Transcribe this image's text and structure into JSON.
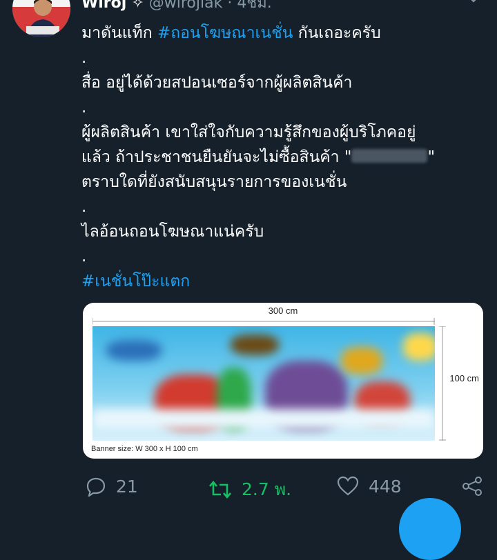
{
  "tweet": {
    "author_name": "Wiroj",
    "author_name_tail": "✧",
    "handle": "@wirojlak",
    "separator": "·",
    "time": "4ชม.",
    "lines": {
      "l1_pre": "มาดันแท็ก ",
      "l1_tag": "#ถอนโฆษณาเนชั่น",
      "l1_post": " กันเถอะครับ",
      "dot1": ".",
      "l2": "สื่อ อยู่ได้ด้วยสปอนเซอร์จากผู้ผลิตสินค้า",
      "dot2": ".",
      "l3": "ผู้ผลิตสินค้า เขาใส่ใจกับความรู้สึกของผู้บริโภคอยู่",
      "l4_pre": "แล้ว ถ้าประชาชนยืนยันจะไม่ซื้อสินค้า \"",
      "l4_post": "\"",
      "l5": "ตราบใดที่ยังสนับสนุนรายการของเนชั่น",
      "dot3": ".",
      "l6": "ไลอ้อนถอนโฆษณาแน่ครับ",
      "dot4": ".",
      "l7_tag": "#เนชั่นโป๊ะแตก"
    }
  },
  "media": {
    "width_label": "300 cm",
    "height_label": "100 cm",
    "banner_size_label": "Banner size: W 300 x H 100 cm"
  },
  "actions": {
    "reply_count": "21",
    "retweet_count": "2.7 พ.",
    "like_count": "448"
  },
  "colors": {
    "background": "#15202b",
    "accent": "#1da1f2",
    "retweet": "#17bf63",
    "muted": "#8899a6"
  },
  "icons": [
    "chevron-down-icon",
    "reply-icon",
    "retweet-icon",
    "heart-icon",
    "share-icon",
    "compose-icon"
  ]
}
